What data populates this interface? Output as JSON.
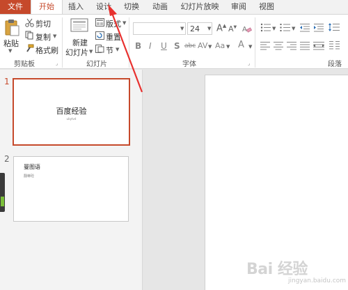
{
  "tabs": [
    "文件",
    "开始",
    "插入",
    "设计",
    "切换",
    "动画",
    "幻灯片放映",
    "审阅",
    "视图"
  ],
  "clipboard": {
    "paste": "粘贴",
    "cut": "剪切",
    "copy": "复制",
    "format_painter": "格式刷",
    "group": "剪贴板"
  },
  "slides_group": {
    "new_slide_line1": "新建",
    "new_slide_line2": "幻灯片",
    "layout": "版式",
    "reset": "重置",
    "section": "节",
    "group": "幻灯片"
  },
  "font_group": {
    "font_size": "24",
    "bold": "B",
    "italic": "I",
    "underline": "U",
    "shadow": "S",
    "strikethrough": "abc",
    "spacing": "AV",
    "change_case": "Aa",
    "font_color": "A",
    "grow": "A",
    "shrink": "A",
    "group": "字体"
  },
  "paragraph_group": {
    "group": "段落"
  },
  "slide_thumbs": [
    {
      "number": "1",
      "title": "百度经验",
      "subtitle": "ubytvd"
    },
    {
      "number": "2",
      "title": "曼图语",
      "subtitle": "翻蒂硷"
    }
  ],
  "watermark": {
    "text": "Bai 经验",
    "sub": "jingyan.baidu.com"
  },
  "colors": {
    "accent": "#c6492b",
    "arrow": "#e8312f"
  }
}
